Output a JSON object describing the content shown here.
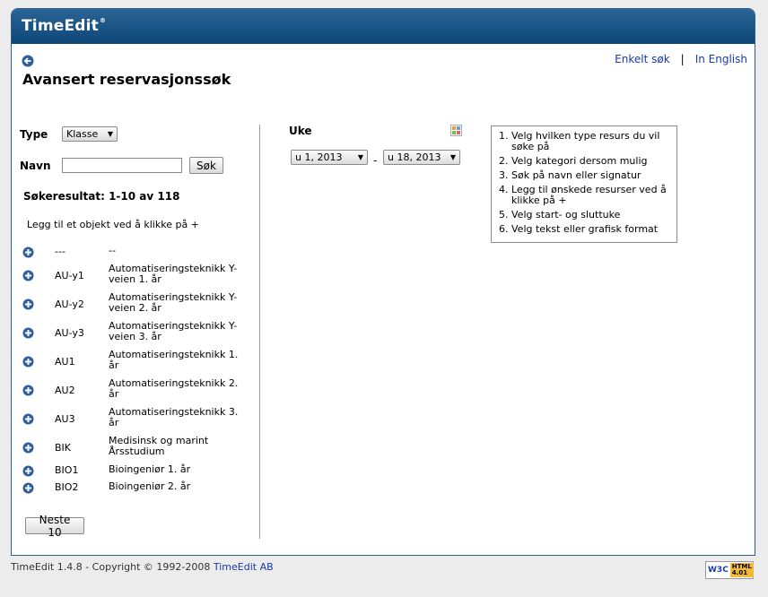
{
  "app": {
    "logo": "TimeEdit",
    "trademark": "®"
  },
  "nav": {
    "simple_search": "Enkelt søk",
    "separator": "|",
    "english": "In English"
  },
  "page_title": "Avansert reservasjonssøk",
  "form": {
    "type_label": "Type",
    "type_value": "Klasse",
    "name_label": "Navn",
    "name_value": "",
    "search_button": "Søk"
  },
  "results": {
    "title": "Søkeresultat: 1-10 av 118",
    "hint": "Legg til et objekt ved å klikke på +",
    "rows": [
      {
        "code": "---",
        "name": "--"
      },
      {
        "code": "AU-y1",
        "name": "Automatiseringsteknikk Y-veien 1. år"
      },
      {
        "code": "AU-y2",
        "name": "Automatiseringsteknikk Y-veien 2. år"
      },
      {
        "code": "AU-y3",
        "name": "Automatiseringsteknikk Y-veien 3. år"
      },
      {
        "code": "AU1",
        "name": "Automatiseringsteknikk 1. år"
      },
      {
        "code": "AU2",
        "name": "Automatiseringsteknikk 2. år"
      },
      {
        "code": "AU3",
        "name": "Automatiseringsteknikk 3. år"
      },
      {
        "code": "BIK",
        "name": "Medisinsk og marint Årsstudium"
      },
      {
        "code": "BIO1",
        "name": "Bioingeniør 1. år"
      },
      {
        "code": "BIO2",
        "name": "Bioingeniør 2. år"
      }
    ],
    "next_button": "Neste 10"
  },
  "week": {
    "label": "Uke",
    "from": "u 1, 2013",
    "dash": "-",
    "to": "u 18, 2013"
  },
  "instructions": [
    "Velg hvilken type resurs du vil søke på",
    "Velg kategori dersom mulig",
    "Søk på navn eller signatur",
    "Legg til ønskede resurser ved å klikke på +",
    "Velg start- og sluttuke",
    "Velg tekst eller grafisk format"
  ],
  "footer": {
    "text": "TimeEdit 1.4.8 - Copyright © 1992-2008",
    "link": "TimeEdit AB"
  },
  "badge": {
    "w3c": "W3C",
    "html": "HTML",
    "version": "4.01"
  },
  "colors": {
    "header": "#0d4777",
    "link": "#1a3aa5",
    "add_icon": "#2f5f9a"
  }
}
